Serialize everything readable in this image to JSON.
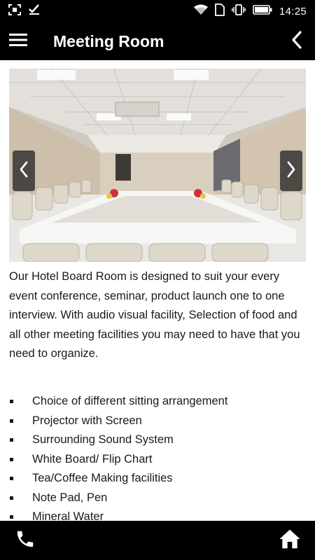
{
  "status_bar": {
    "time": "14:25",
    "left_icons": [
      "screenshot-icon",
      "check-icon"
    ],
    "right_icons": [
      "wifi-icon",
      "sim-icon",
      "vibrate-icon",
      "battery-icon"
    ]
  },
  "app_bar": {
    "title": "Meeting Room",
    "menu_icon": "hamburger-menu-icon",
    "back_icon": "chevron-left-icon"
  },
  "carousel": {
    "prev_icon": "chevron-left-icon",
    "next_icon": "chevron-right-icon"
  },
  "description": "Our Hotel Board Room is designed to suit your every event conference, seminar, product launch one to one interview. With audio visual facility, Selection of food and all other meeting facilities you may need to have that you need to organize.",
  "features": [
    "Choice of different sitting arrangement",
    "Projector with Screen",
    "Surrounding Sound System",
    "White Board/ Flip Chart",
    "Tea/Coffee Making facilities",
    "Note Pad, Pen",
    "Mineral Water"
  ],
  "bottom_bar": {
    "left_icon": "phone-icon",
    "right_icon": "home-icon"
  }
}
